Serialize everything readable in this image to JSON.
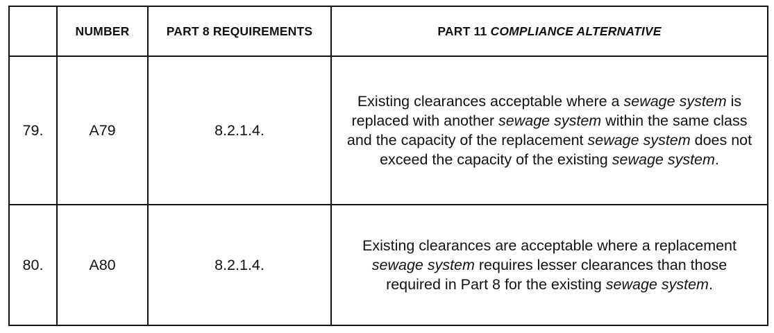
{
  "header": {
    "col_index": "",
    "col_number": "NUMBER",
    "col_part8": "PART 8 REQUIREMENTS",
    "col_part11_prefix": "PART 11 ",
    "col_part11_italic": "COMPLIANCE ALTERNATIVE"
  },
  "rows": [
    {
      "index": "79.",
      "number": "A79",
      "part8": "8.2.1.4.",
      "alt": [
        {
          "t": "Existing clearances acceptable where a ",
          "i": false
        },
        {
          "t": "sewage system",
          "i": true
        },
        {
          "t": " is replaced with another ",
          "i": false
        },
        {
          "t": "sewage system",
          "i": true
        },
        {
          "t": " within the same class and the capacity of the replacement ",
          "i": false
        },
        {
          "t": "sewage system",
          "i": true
        },
        {
          "t": " does not exceed the capacity of the existing ",
          "i": false
        },
        {
          "t": "sewage system",
          "i": true
        },
        {
          "t": ".",
          "i": false
        }
      ]
    },
    {
      "index": "80.",
      "number": "A80",
      "part8": "8.2.1.4.",
      "alt": [
        {
          "t": "Existing clearances are acceptable where a replacement ",
          "i": false
        },
        {
          "t": "sewage system",
          "i": true
        },
        {
          "t": " requires lesser clearances than those required in Part 8 for the existing ",
          "i": false
        },
        {
          "t": "sewage system",
          "i": true
        },
        {
          "t": ".",
          "i": false
        }
      ]
    }
  ]
}
